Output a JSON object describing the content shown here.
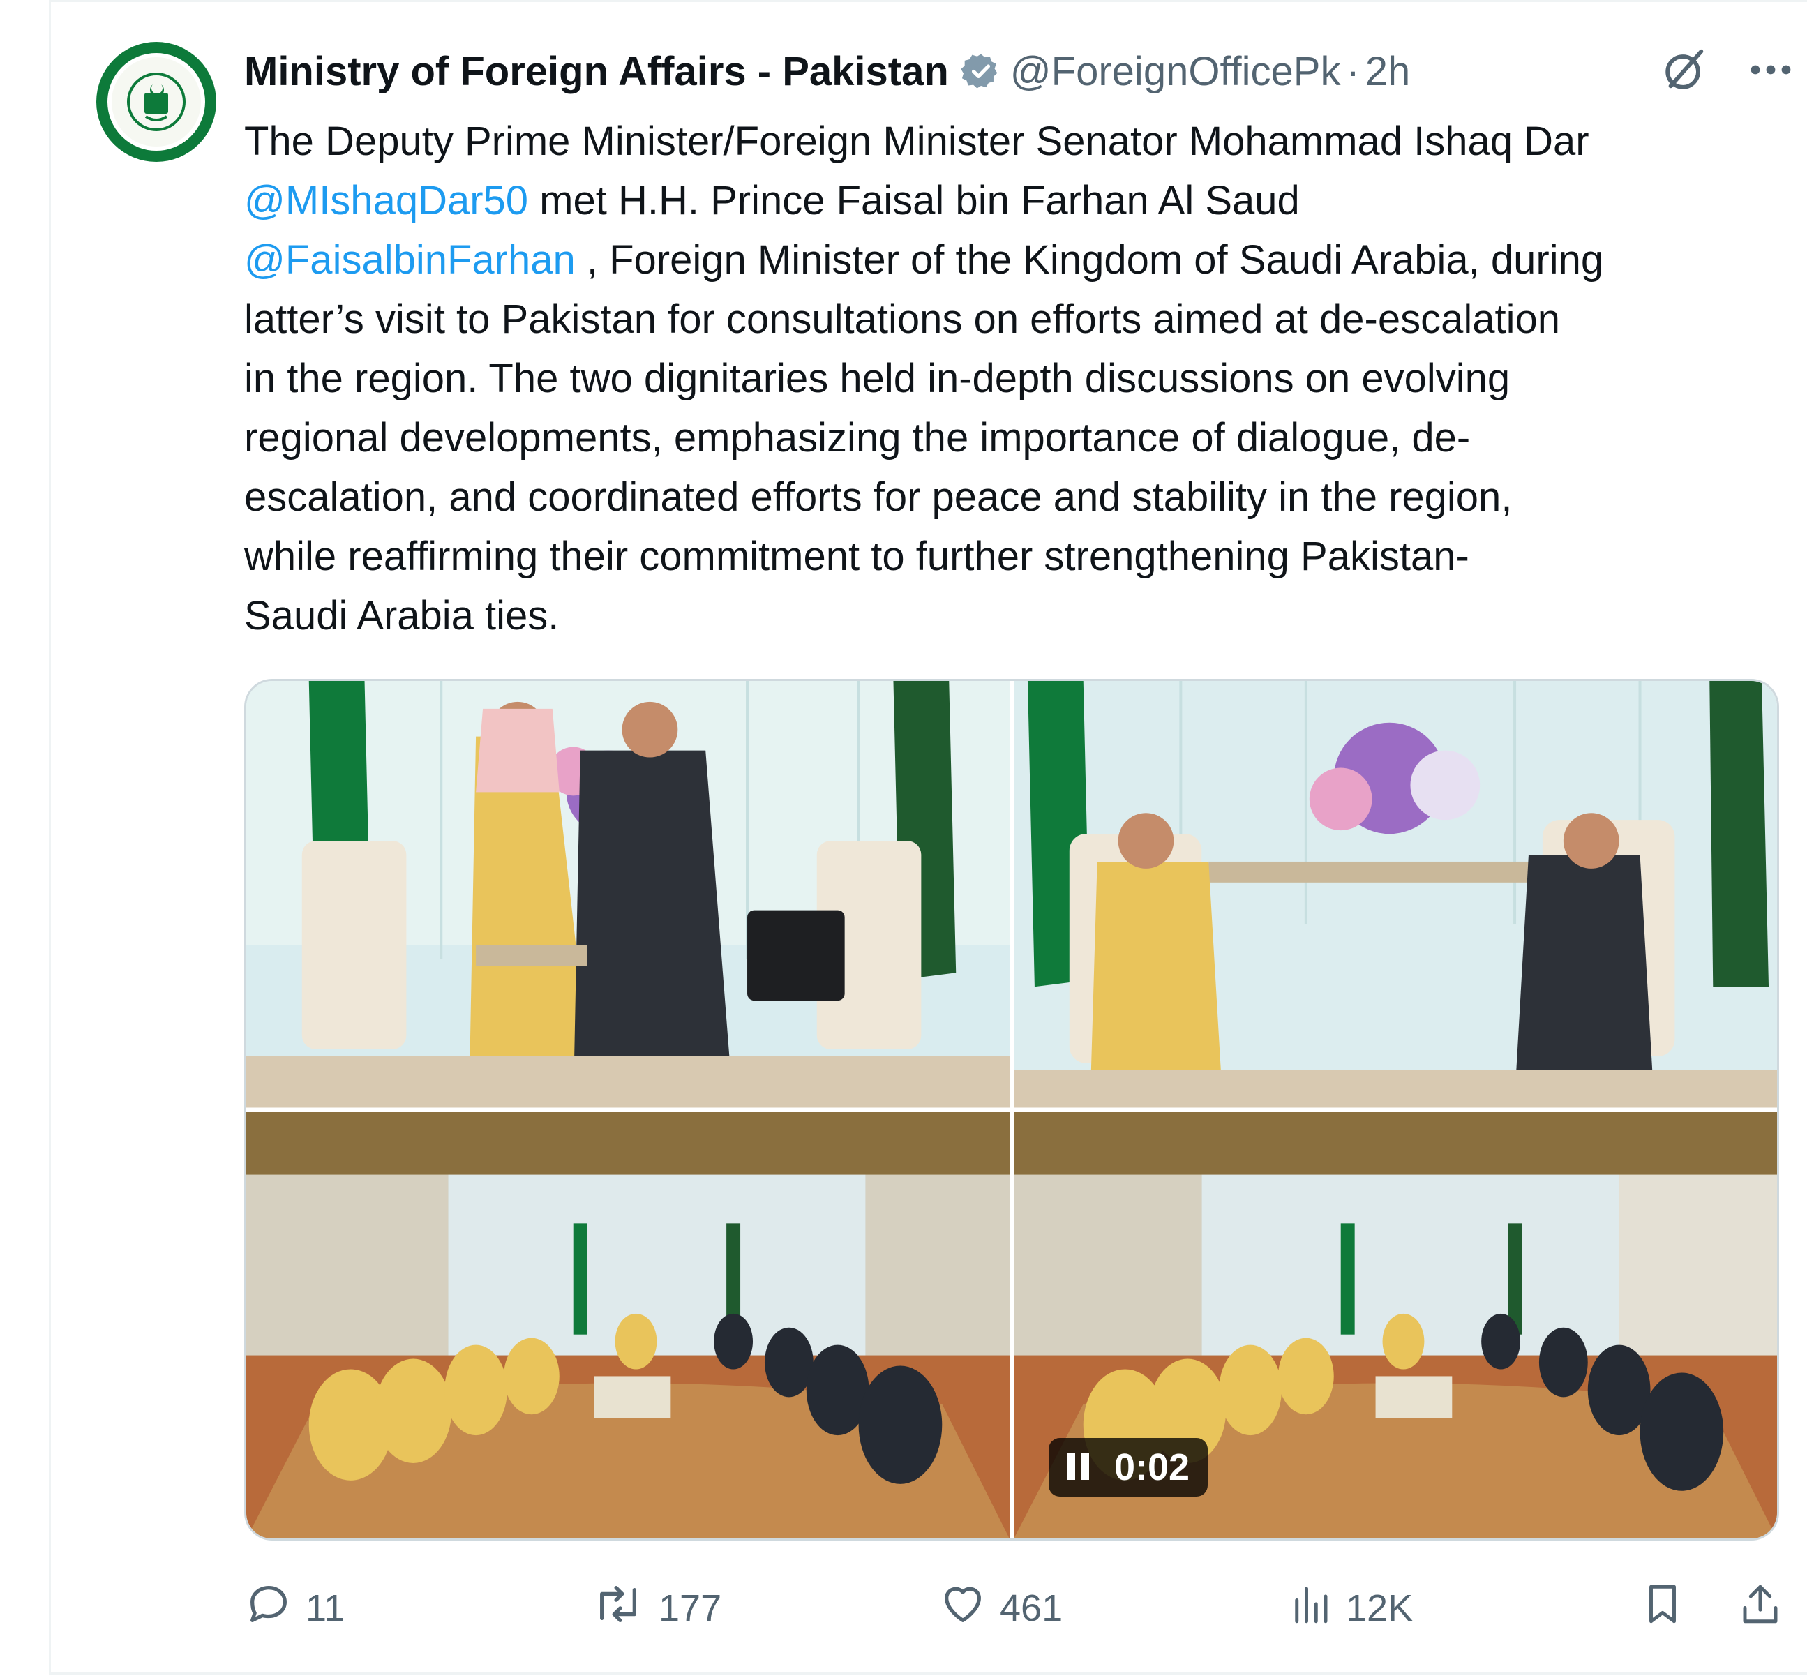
{
  "tweet": {
    "display_name": "Ministry of Foreign Affairs - Pakistan",
    "handle": "@ForeignOfficePk",
    "separator": "·",
    "time": "2h",
    "text_parts": [
      "The Deputy Prime Minister/Foreign Minister Senator Mohammad Ishaq Dar\n",
      "@MIshaqDar50",
      " met H.H. Prince Faisal bin Farhan Al Saud\n",
      "@FaisalbinFarhan",
      " , Foreign Minister of the Kingdom of Saudi Arabia, during\nlatter’s visit to Pakistan for consultations on efforts aimed at de-escalation\nin the region. The two dignitaries held in-depth discussions on evolving\nregional developments, emphasizing the importance of dialogue, de-\nescalation, and coordinated efforts for peace and stability in the region,\nwhile reaffirming their commitment to further strengthening Pakistan-\nSaudi Arabia ties."
    ],
    "video_time": "0:02"
  },
  "actions": {
    "replies": "11",
    "reposts": "177",
    "likes": "461",
    "views": "12K"
  },
  "icons": {
    "verified": "verified-badge-icon",
    "grok": "grok-icon",
    "more": "more-icon",
    "reply": "reply-icon",
    "repost": "repost-icon",
    "like": "like-icon",
    "views": "views-icon",
    "bookmark": "bookmark-icon",
    "share": "share-icon",
    "pause": "pause-icon"
  },
  "colors": {
    "link": "#1d9bf0",
    "muted": "#536471",
    "verified": "#829aab",
    "avatar_green": "#0d7a3a"
  }
}
